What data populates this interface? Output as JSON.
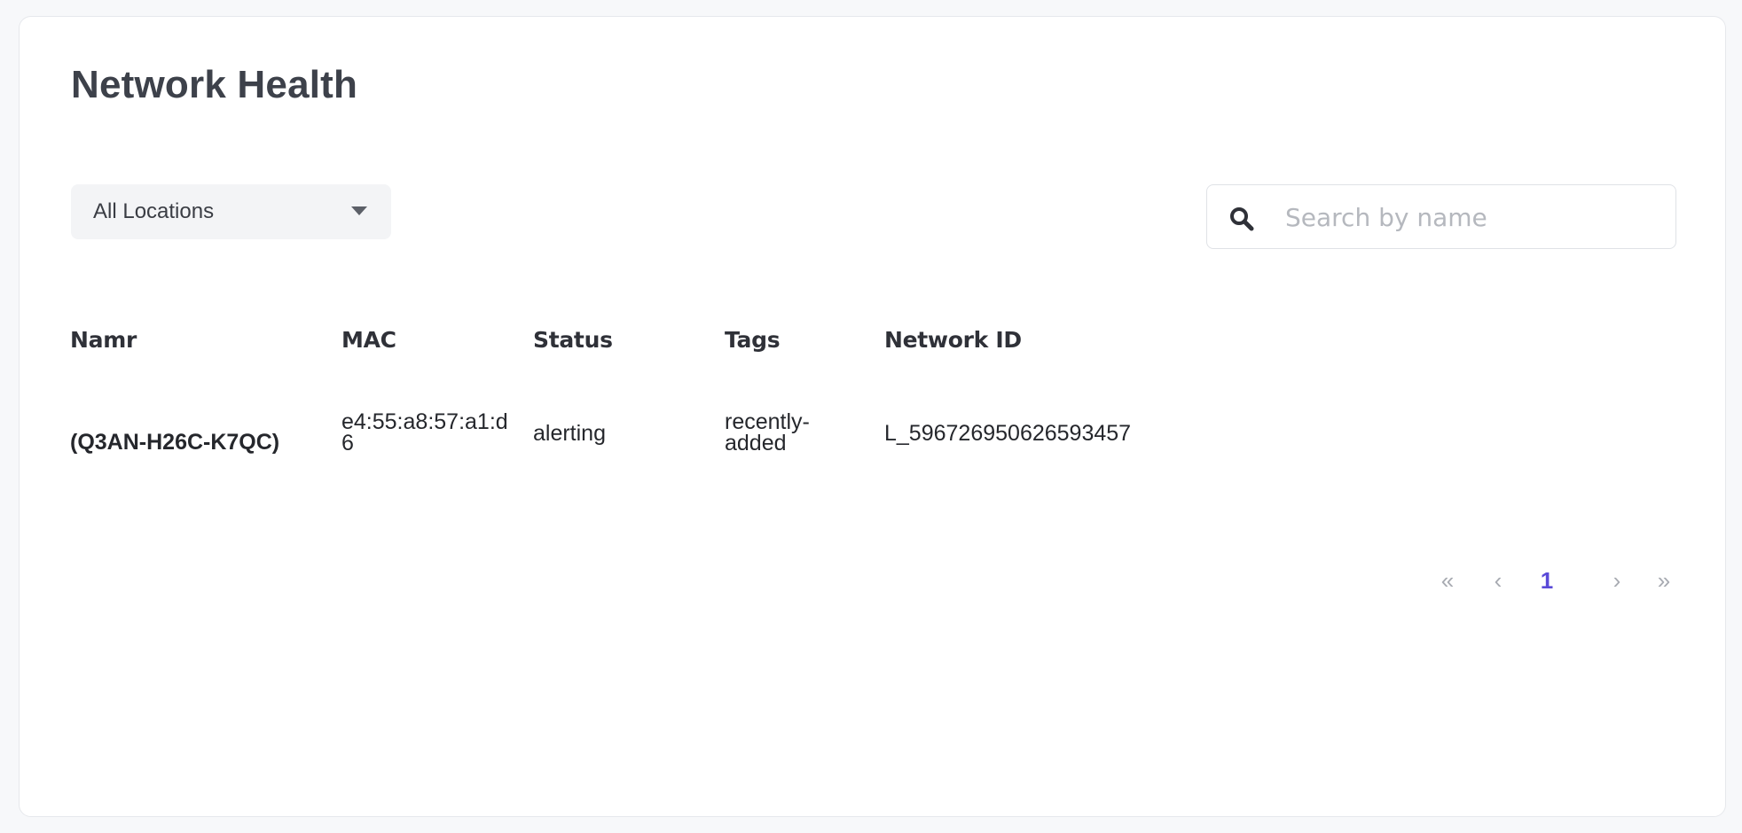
{
  "header": {
    "title": "Network Health"
  },
  "filters": {
    "location_selected": "All Locations",
    "search_placeholder": "Search by name",
    "search_value": ""
  },
  "table": {
    "columns": [
      "Namr",
      "MAC",
      "Status",
      "Tags",
      "Network ID"
    ],
    "rows": [
      {
        "name": "(Q3AN-H26C-K7QC)",
        "mac_line1": "e4:55:a8:57:a1:d",
        "mac_line2": "6",
        "status": "alerting",
        "tags_line1": "recently-",
        "tags_line2": "added",
        "network_id": "L_596726950626593457"
      }
    ]
  },
  "pagination": {
    "first": "«",
    "prev": "‹",
    "current_page": "1",
    "next": "›",
    "last": "»"
  },
  "icons": {
    "search": "search-icon",
    "dropdown": "chevron-down-icon"
  },
  "colors": {
    "accent": "#5a4ad8",
    "background": "#f7f8fa",
    "card": "#ffffff"
  }
}
